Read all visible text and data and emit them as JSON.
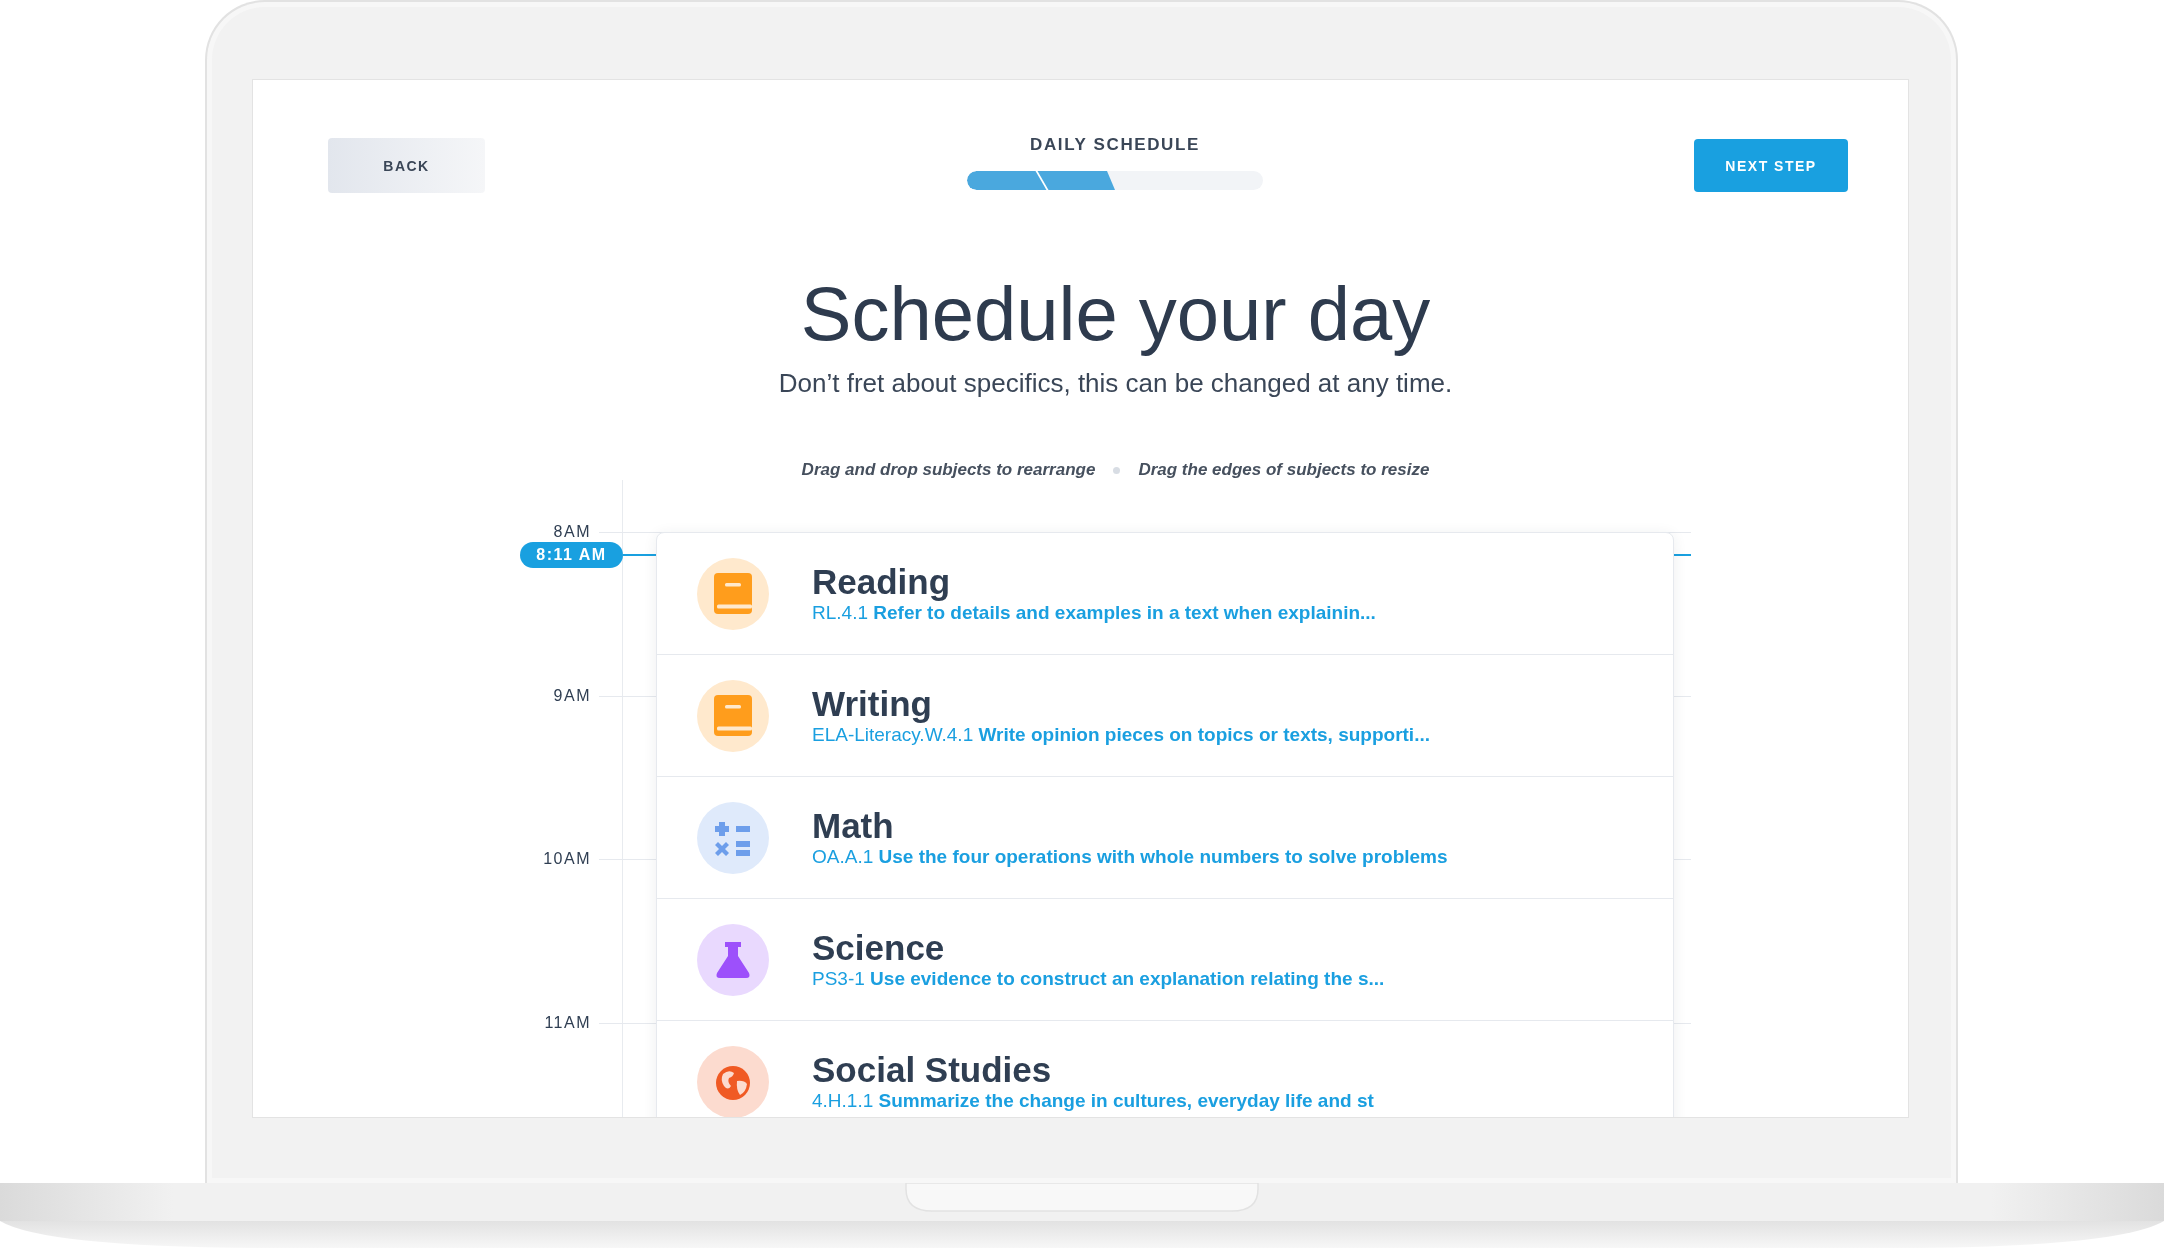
{
  "header": {
    "back_button": "BACK",
    "step_title": "DAILY SCHEDULE",
    "progress": {
      "level": 0.5
    },
    "next_button": "NEXT STEP"
  },
  "heading": "Schedule your day",
  "subheading": "Don’t fret about specifics, this can be changed at any time.",
  "hints": [
    "Drag and drop subjects to rearrange",
    "Drag the edges of subjects to resize"
  ],
  "timeline": {
    "hours": [
      "8AM",
      "9AM",
      "10AM",
      "11AM"
    ],
    "current_time": "8:11 AM",
    "subjects": [
      {
        "kind": "literacy",
        "color": "#ff9d1c",
        "title": "Reading",
        "standard": "RL.4.1 **Refer to details and examples in a text when explainin...**"
      },
      {
        "kind": "literacy",
        "color": "#ff9d1c",
        "title": "Writing",
        "standard": "ELA-Literacy.W.4.1 **Write opinion pieces on topics or texts, supporti...**"
      },
      {
        "kind": "math",
        "color": "#6d9eeb",
        "title": "Math",
        "standard": "OA.A.1 **Use the four operations with whole numbers to solve problems**"
      },
      {
        "kind": "science",
        "color": "#9d50fb",
        "title": "Science",
        "standard": "PS3-1 **Use evidence to construct an explanation relating the s...**"
      },
      {
        "kind": "social",
        "color": "#f05a24",
        "title": "Social Studies",
        "standard": "4.H.1.1 **Summarize the change in cultures, everyday life and st**"
      }
    ]
  }
}
